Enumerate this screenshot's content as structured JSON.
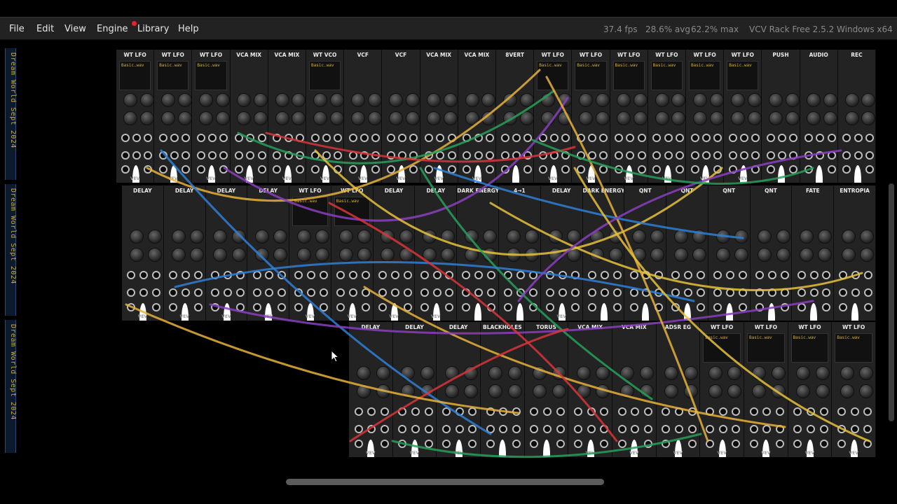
{
  "menubar": {
    "items": [
      {
        "label": "File",
        "name": "menu-file"
      },
      {
        "label": "Edit",
        "name": "menu-edit"
      },
      {
        "label": "View",
        "name": "menu-view"
      },
      {
        "label": "Engine",
        "name": "menu-engine"
      },
      {
        "label": "Library",
        "name": "menu-library",
        "notification": true
      },
      {
        "label": "Help",
        "name": "menu-help"
      }
    ],
    "fps": "37.4 fps",
    "avg": "28.6% avg",
    "max": "62.2% max",
    "version": "VCV Rack Free 2.5.2 Windows x64"
  },
  "rack_rail_text": "Dream World Sept 2024",
  "rows": [
    {
      "modules": [
        {
          "title": "WT LFO",
          "wave": "Basic.wav",
          "brand": "VEV"
        },
        {
          "title": "WT LFO",
          "wave": "Basic.wav",
          "brand": "VEV"
        },
        {
          "title": "WT LFO",
          "wave": "Basic.wav",
          "brand": "VEV"
        },
        {
          "title": "VCA MIX",
          "wave": "",
          "brand": "VEV"
        },
        {
          "title": "VCA MIX",
          "wave": "",
          "brand": "VEV"
        },
        {
          "title": "WT VCO",
          "wave": "Basic.wav",
          "brand": "VEV"
        },
        {
          "title": "VCF",
          "wave": "",
          "brand": "VEV"
        },
        {
          "title": "VCF",
          "wave": "",
          "brand": "VEV"
        },
        {
          "title": "VCA MIX",
          "wave": "",
          "brand": "VEV"
        },
        {
          "title": "VCA MIX",
          "wave": "",
          "brand": "VEV"
        },
        {
          "title": "8VERT",
          "wave": "",
          "brand": ""
        },
        {
          "title": "WT LFO",
          "wave": "Basic.wav",
          "brand": "VEV"
        },
        {
          "title": "WT LFO",
          "wave": "Basic.wav",
          "brand": "VEV"
        },
        {
          "title": "WT LFO",
          "wave": "Basic.wav",
          "brand": "VEV"
        },
        {
          "title": "WT LFO",
          "wave": "Basic.wav",
          "brand": "VEV"
        },
        {
          "title": "WT LFO",
          "wave": "Basic.wav",
          "brand": "VEV"
        },
        {
          "title": "WT LFO",
          "wave": "Basic.wav",
          "brand": "VEV"
        },
        {
          "title": "PUSH",
          "wave": "",
          "brand": ""
        },
        {
          "title": "AUDIO",
          "wave": "",
          "brand": ""
        },
        {
          "title": "REC",
          "wave": "",
          "brand": ""
        }
      ]
    },
    {
      "modules": [
        {
          "title": "DELAY",
          "wave": "",
          "brand": "VEV"
        },
        {
          "title": "DELAY",
          "wave": "",
          "brand": "VEV"
        },
        {
          "title": "DELAY",
          "wave": "",
          "brand": "VEV"
        },
        {
          "title": "DELAY",
          "wave": "",
          "brand": "VEV"
        },
        {
          "title": "WT LFO",
          "wave": "Basic.wav",
          "brand": "VEV"
        },
        {
          "title": "WT LFO",
          "wave": "Basic.wav",
          "brand": "VEV"
        },
        {
          "title": "DELAY",
          "wave": "",
          "brand": "VEV"
        },
        {
          "title": "DELAY",
          "wave": "",
          "brand": "VEV"
        },
        {
          "title": "DARK ENERGY",
          "wave": "",
          "brand": ""
        },
        {
          "title": "4→1",
          "wave": "",
          "brand": ""
        },
        {
          "title": "DELAY",
          "wave": "",
          "brand": "VEV"
        },
        {
          "title": "DARK ENERGY",
          "wave": "",
          "brand": ""
        },
        {
          "title": "QNT",
          "wave": "",
          "brand": ""
        },
        {
          "title": "QNT",
          "wave": "",
          "brand": ""
        },
        {
          "title": "QNT",
          "wave": "",
          "brand": ""
        },
        {
          "title": "QNT",
          "wave": "",
          "brand": ""
        },
        {
          "title": "FATE",
          "wave": "",
          "brand": ""
        },
        {
          "title": "ENTROPIA",
          "wave": "",
          "brand": ""
        }
      ]
    },
    {
      "modules": [
        {
          "title": "DELAY",
          "wave": "",
          "brand": "VEV"
        },
        {
          "title": "DELAY",
          "wave": "",
          "brand": "VEV"
        },
        {
          "title": "DELAY",
          "wave": "",
          "brand": "VEV"
        },
        {
          "title": "BLACKHOLES",
          "wave": "",
          "brand": ""
        },
        {
          "title": "TORUS",
          "wave": "",
          "brand": ""
        },
        {
          "title": "VCA MIX",
          "wave": "",
          "brand": "VEV"
        },
        {
          "title": "VCA MIX",
          "wave": "",
          "brand": "VEV"
        },
        {
          "title": "ADSR EG",
          "wave": "",
          "brand": "VEV"
        },
        {
          "title": "WT LFO",
          "wave": "Basic.wav",
          "brand": "VEV"
        },
        {
          "title": "WT LFO",
          "wave": "Basic.wav",
          "brand": "VEV"
        },
        {
          "title": "WT LFO",
          "wave": "Basic.wav",
          "brand": "VEV"
        },
        {
          "title": "WT LFO",
          "wave": "Basic.wav",
          "brand": "VEV"
        }
      ]
    }
  ],
  "cable_colors": [
    "#e8b23a",
    "#27a05a",
    "#2f7fd6",
    "#8a3fc0",
    "#d8353a",
    "#e7c23a"
  ]
}
